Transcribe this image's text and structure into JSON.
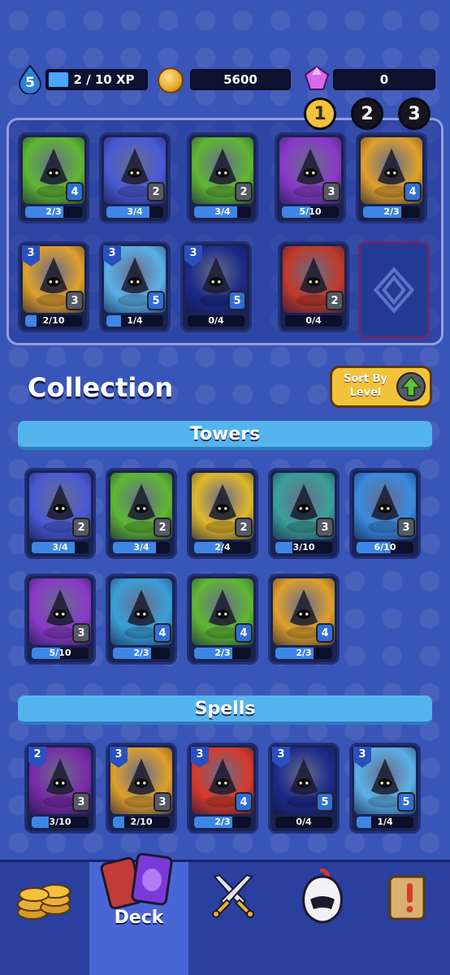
{
  "player": {
    "level": "5",
    "xp": "2 / 10 XP",
    "xp_fraction": 0.2,
    "coins": "5600",
    "gems": "0"
  },
  "deck_tabs": [
    {
      "label": "1",
      "active": true
    },
    {
      "label": "2",
      "active": false
    },
    {
      "label": "3",
      "active": false
    }
  ],
  "deck_cards": [
    {
      "name": "plague-doctor-tower",
      "color": "#5fb832",
      "level": "4",
      "progress": "2/3",
      "frac": 0.67,
      "blue": true
    },
    {
      "name": "ice-golem-tower",
      "color": "#4a5ad6",
      "level": "2",
      "progress": "3/4",
      "frac": 0.75
    },
    {
      "name": "green-druid-tower",
      "color": "#5fb832",
      "level": "2",
      "progress": "3/4",
      "frac": 0.75
    },
    {
      "name": "horned-wizard-tower",
      "color": "#8a3ac8",
      "level": "3",
      "progress": "5/10",
      "frac": 0.5
    },
    {
      "name": "goggles-crossbow-tower",
      "color": "#e0a02a",
      "level": "4",
      "progress": "2/3",
      "frac": 0.67,
      "blue": true
    },
    {
      "name": "sun-beam-spell",
      "color": "#e0a02a",
      "cost": "3",
      "level": "3",
      "progress": "2/10",
      "frac": 0.2
    },
    {
      "name": "frost-hammer-spell",
      "color": "#5bb0e8",
      "cost": "3",
      "level": "5",
      "progress": "1/4",
      "frac": 0.25,
      "blue": true
    },
    {
      "name": "ice-shard-spell",
      "color": "#1d2a8a",
      "cost": "3",
      "level": "5",
      "progress": "0/4",
      "frac": 0,
      "blue": true
    },
    {
      "name": "barbarian-squad",
      "color": "#c23a2a",
      "level": "2",
      "progress": "0/4",
      "frac": 0
    }
  ],
  "collection_title": "Collection",
  "sort_button": {
    "line1": "Sort By",
    "line2": "Level"
  },
  "towers_header": "Towers",
  "towers": [
    {
      "name": "ice-golem-tower",
      "color": "#4a5ad6",
      "level": "2",
      "progress": "3/4",
      "frac": 0.75
    },
    {
      "name": "green-druid-tower",
      "color": "#5fb832",
      "level": "2",
      "progress": "3/4",
      "frac": 0.75
    },
    {
      "name": "yellow-mage-tower",
      "color": "#e0b82a",
      "level": "2",
      "progress": "2/4",
      "frac": 0.5
    },
    {
      "name": "archer-tower",
      "color": "#3aa09a",
      "level": "3",
      "progress": "3/10",
      "frac": 0.3
    },
    {
      "name": "frost-mage-tower",
      "color": "#3a8ae0",
      "level": "3",
      "progress": "6/10",
      "frac": 0.6
    },
    {
      "name": "horned-wizard-tower",
      "color": "#8a3ac8",
      "level": "3",
      "progress": "5/10",
      "frac": 0.5
    },
    {
      "name": "knight-tower",
      "color": "#3aa0d8",
      "level": "4",
      "progress": "2/3",
      "frac": 0.67,
      "blue": true
    },
    {
      "name": "plague-doctor-tower",
      "color": "#5fb832",
      "level": "4",
      "progress": "2/3",
      "frac": 0.67,
      "blue": true
    },
    {
      "name": "goggles-crossbow-tower",
      "color": "#e0a02a",
      "level": "4",
      "progress": "2/3",
      "frac": 0.67,
      "blue": true
    }
  ],
  "spells_header": "Spells",
  "spells": [
    {
      "name": "arcane-bolt-spell",
      "color": "#7a2aa8",
      "cost": "2",
      "level": "3",
      "progress": "3/10",
      "frac": 0.3
    },
    {
      "name": "sun-beam-spell",
      "color": "#e0a02a",
      "cost": "3",
      "level": "3",
      "progress": "2/10",
      "frac": 0.2
    },
    {
      "name": "target-curse-spell",
      "color": "#d83a2a",
      "cost": "3",
      "level": "4",
      "progress": "2/3",
      "frac": 0.67,
      "blue": true
    },
    {
      "name": "ice-shard-spell",
      "color": "#1d2a8a",
      "cost": "3",
      "level": "5",
      "progress": "0/4",
      "frac": 0,
      "blue": true
    },
    {
      "name": "frost-hammer-spell",
      "color": "#5bb0e8",
      "cost": "3",
      "level": "5",
      "progress": "1/4",
      "frac": 0.25,
      "blue": true
    }
  ],
  "nav": {
    "deck_label": "Deck"
  },
  "icons": {
    "xp": "drop-icon",
    "coins": "coin-icon",
    "gems": "gem-icon",
    "nav": [
      "coins-stack-icon",
      "card-deck-icon",
      "crossed-swords-icon",
      "knight-helmet-icon",
      "quest-scroll-icon"
    ]
  }
}
